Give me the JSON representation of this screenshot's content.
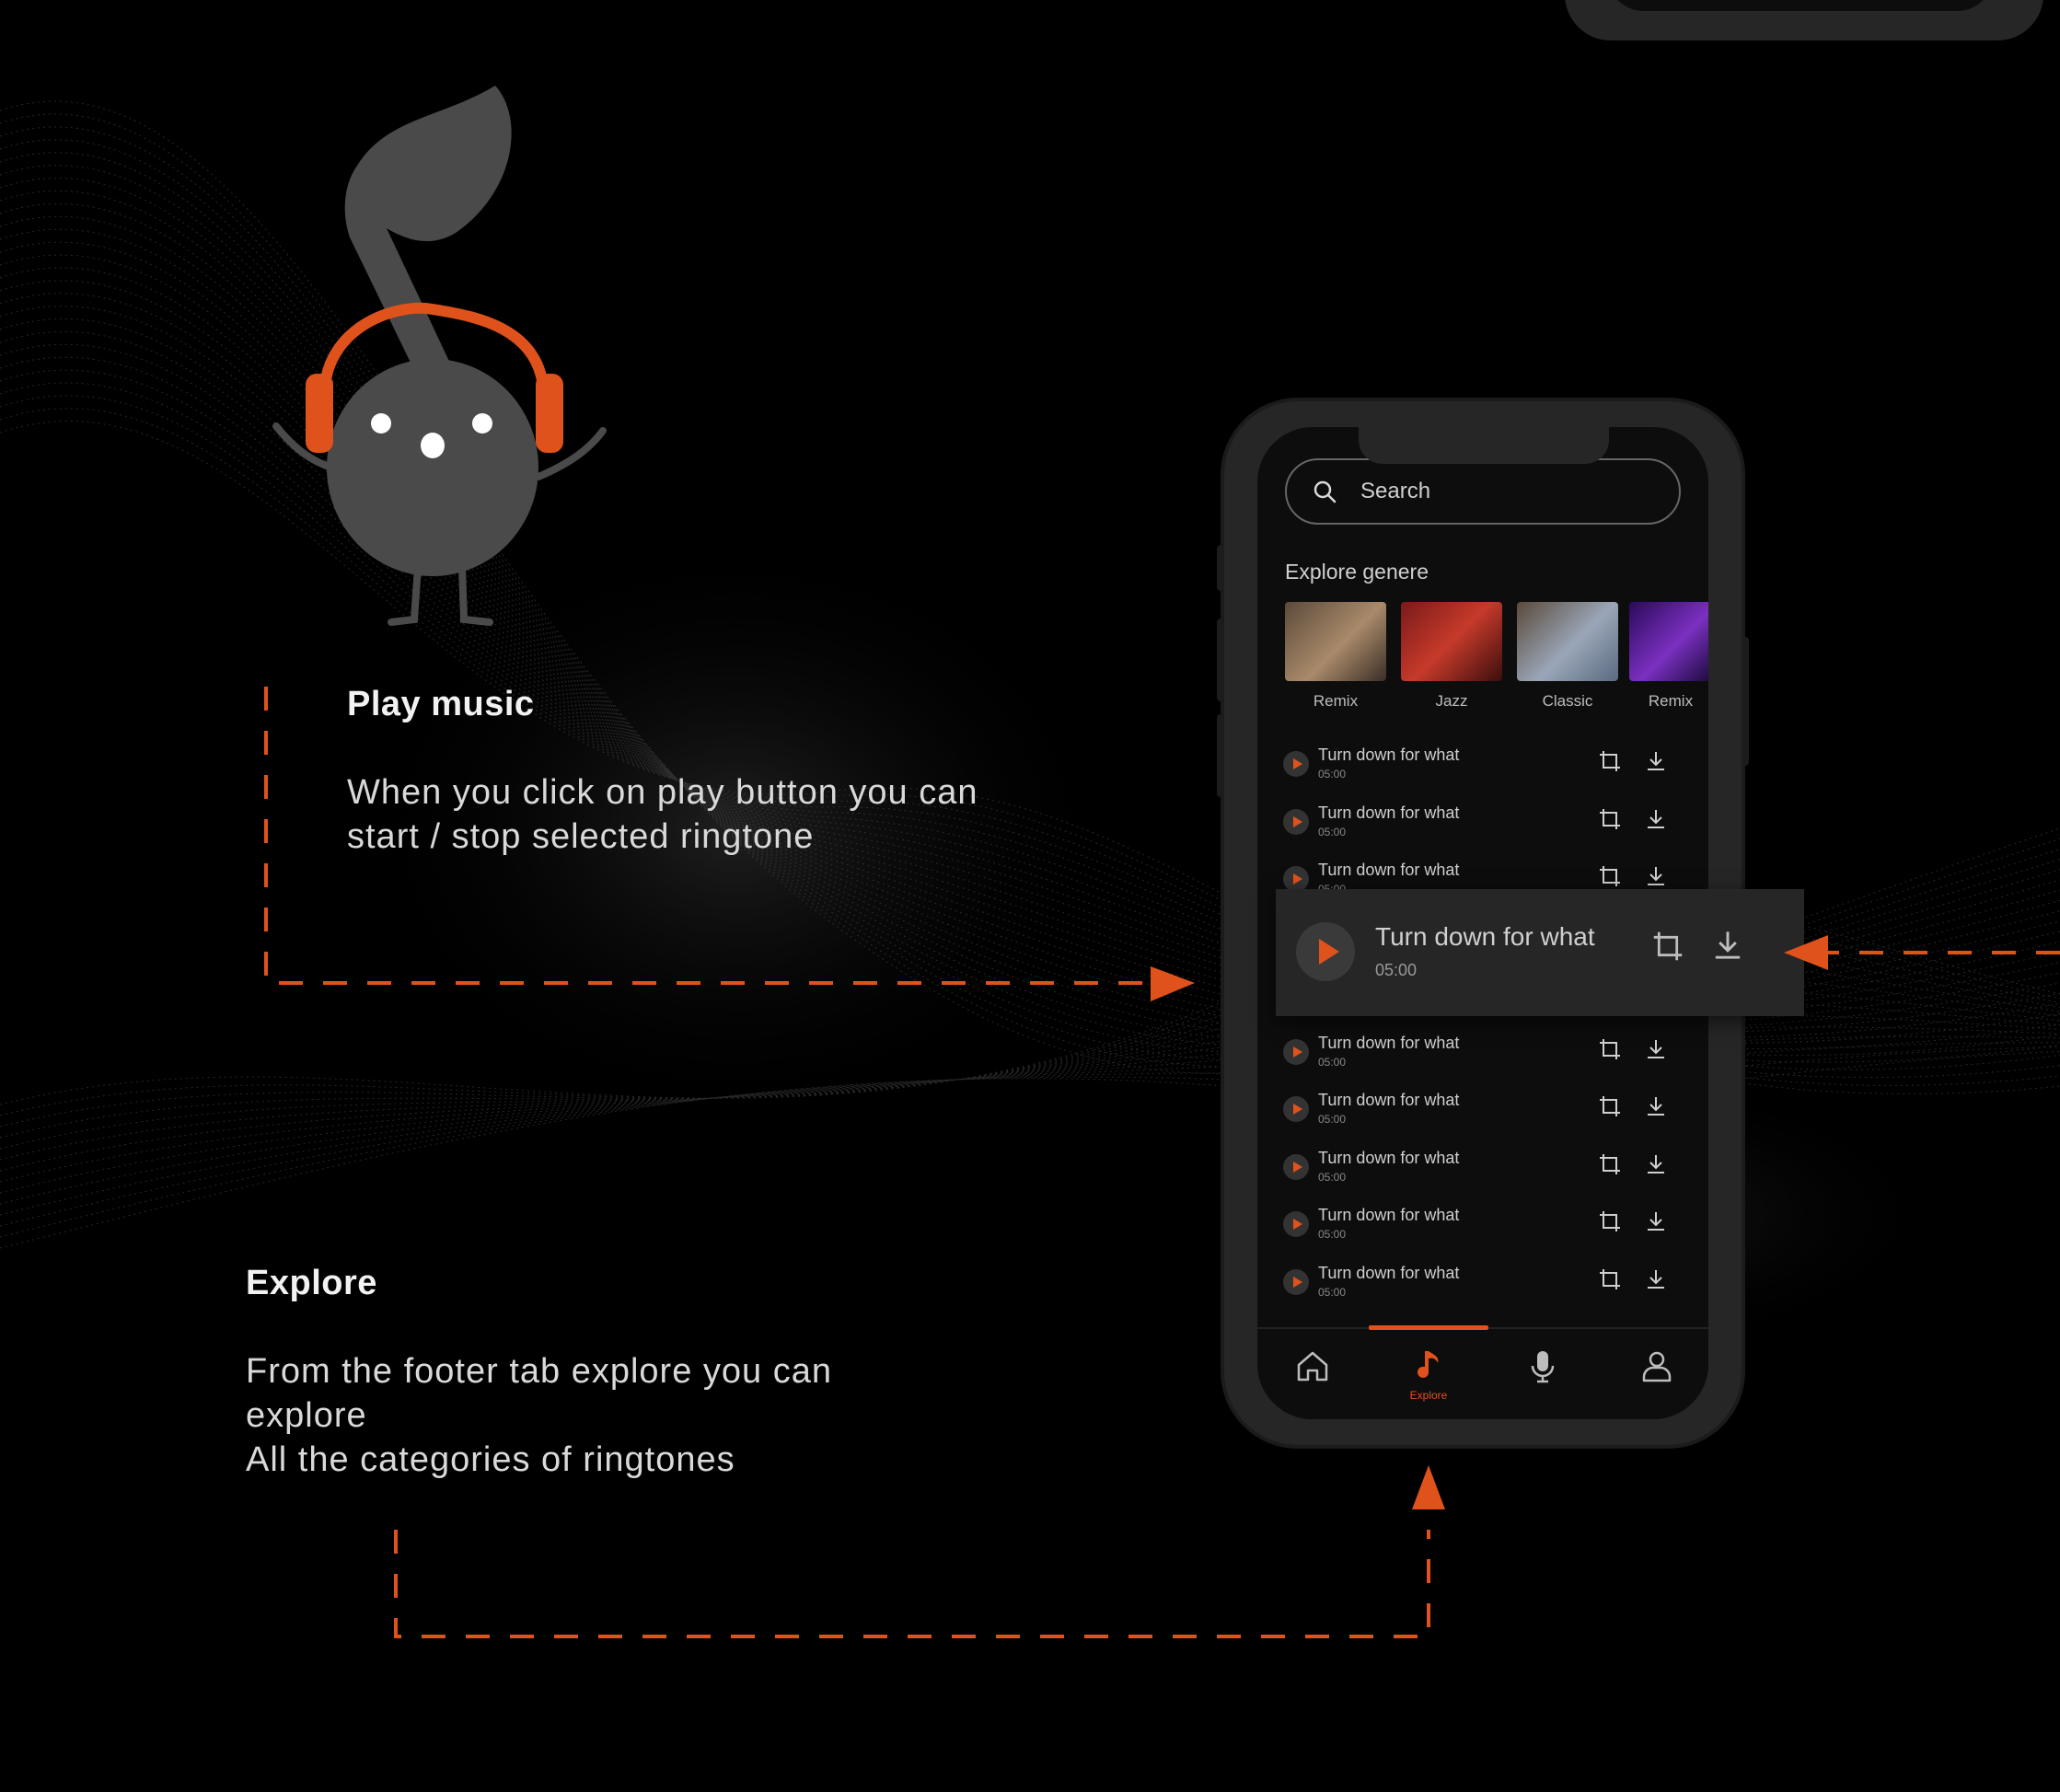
{
  "colors": {
    "accent": "#e0521b",
    "background": "#000000",
    "phone_body": "#262626"
  },
  "annotations": {
    "play_music": {
      "title": "Play music",
      "description": "When you click on play button you can\nstart / stop selected ringtone"
    },
    "explore": {
      "title": "Explore",
      "description": "From the footer tab explore you can\nexplore\nAll the categories of ringtones"
    }
  },
  "app": {
    "search": {
      "placeholder": "Search",
      "icon": "search-icon"
    },
    "section_title": "Explore genere",
    "genres": [
      {
        "label": "Remix"
      },
      {
        "label": "Jazz"
      },
      {
        "label": "Classic"
      },
      {
        "label": "Remix"
      }
    ],
    "tracks": [
      {
        "title": "Turn down for what",
        "duration": "05:00"
      },
      {
        "title": "Turn down for what",
        "duration": "05:00"
      },
      {
        "title": "Turn down for what",
        "duration": "05:00"
      },
      {
        "title": "Turn down for what",
        "duration": "05:00"
      },
      {
        "title": "Turn down for what",
        "duration": "05:00"
      },
      {
        "title": "Turn down for what",
        "duration": "05:00"
      },
      {
        "title": "Turn down for what",
        "duration": "05:00"
      },
      {
        "title": "Turn down for what",
        "duration": "05:00"
      }
    ],
    "highlighted_track": {
      "title": "Turn down for what",
      "duration": "05:00"
    },
    "tabs": [
      {
        "icon": "home-icon",
        "label": ""
      },
      {
        "icon": "music-note-icon",
        "label": "Explore",
        "active": true
      },
      {
        "icon": "microphone-icon",
        "label": ""
      },
      {
        "icon": "user-icon",
        "label": ""
      }
    ]
  }
}
